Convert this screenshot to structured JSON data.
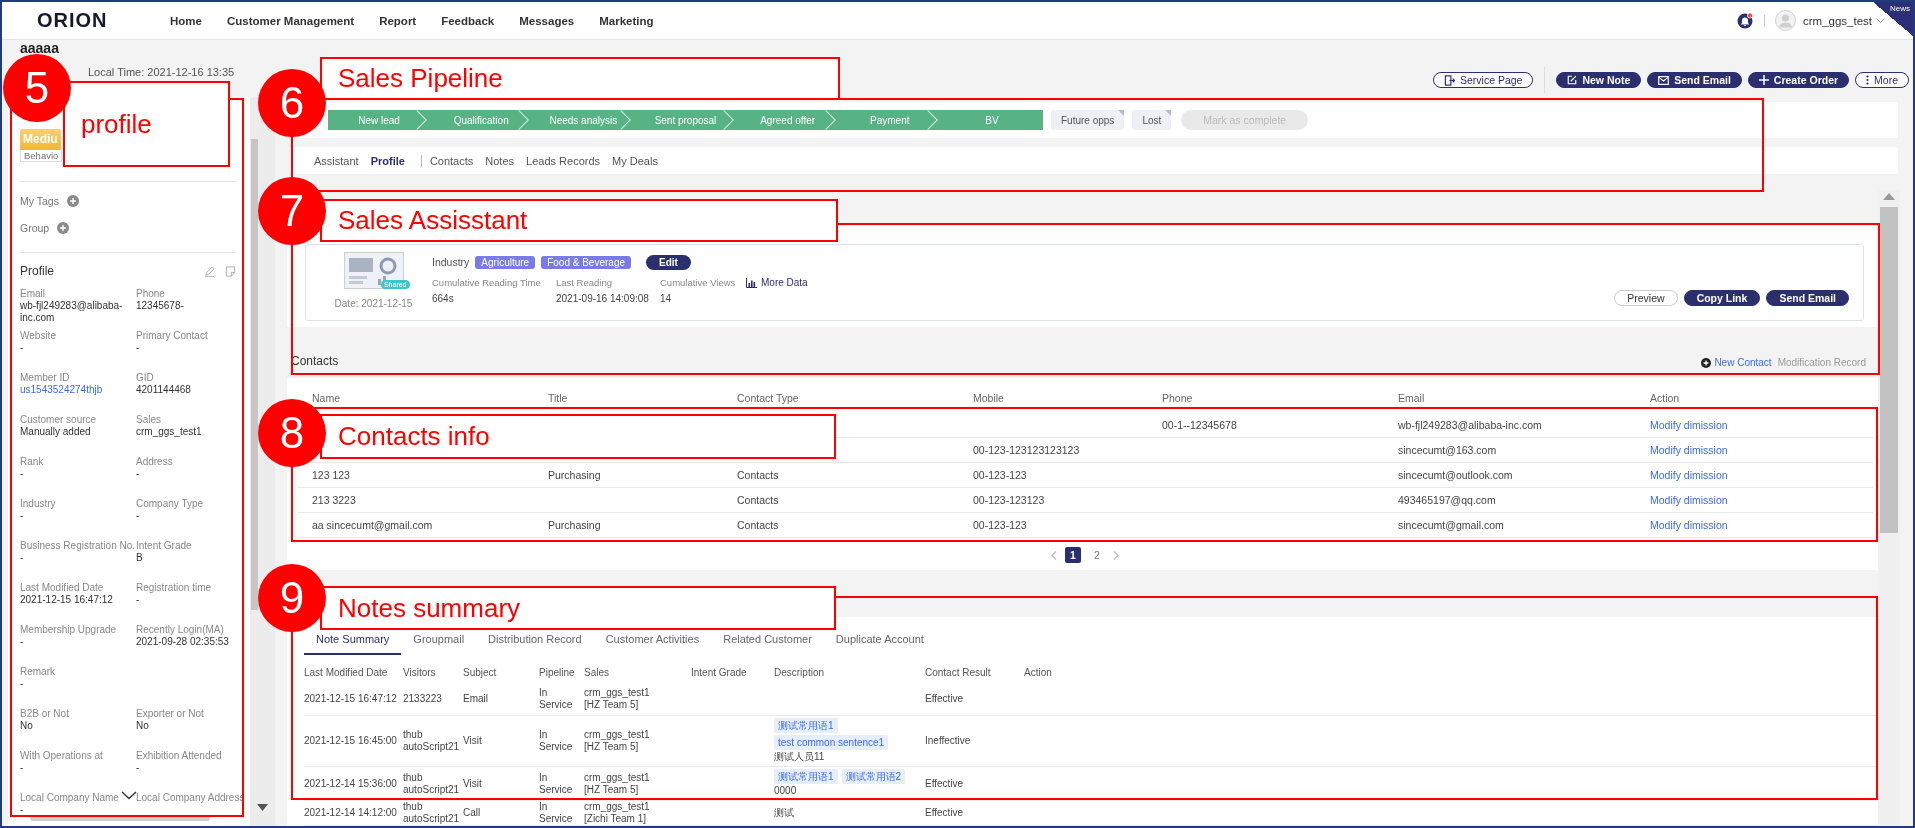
{
  "top_bar": {
    "logo": "ORION",
    "nav": [
      {
        "label": "Home"
      },
      {
        "label": "Customer Management"
      },
      {
        "label": "Report"
      },
      {
        "label": "Feedback"
      },
      {
        "label": "Messages"
      },
      {
        "label": "Marketing"
      }
    ],
    "notifications_unread": true,
    "user": "crm_ggs_test",
    "news": "News"
  },
  "header": {
    "title": "aaaaa",
    "local_time": "Local Time: 2021-12-16 13:35",
    "actions": [
      {
        "label": "Service Page",
        "kind": "service"
      },
      {
        "label": "New Note",
        "kind": "note"
      },
      {
        "label": "Send Email",
        "kind": "email"
      },
      {
        "label": "Create Order",
        "kind": "create"
      },
      {
        "label": "More",
        "kind": "more"
      }
    ]
  },
  "profile_panel": {
    "level_badge": "Mediu",
    "behavior_tag": "Behavio",
    "my_tags": "My Tags",
    "group": "Group",
    "heading": "Profile",
    "fields": [
      {
        "label": "Email",
        "value": "wb-fjl249283@alibaba-inc.com",
        "kind": "text"
      },
      {
        "label": "Phone",
        "value": "12345678-",
        "kind": "text"
      },
      {
        "label": "Website",
        "value": "-",
        "kind": "text"
      },
      {
        "label": "Primary Contact",
        "value": "-",
        "kind": "text"
      },
      {
        "label": "Member ID",
        "value": "us1543524274thjb",
        "kind": "link"
      },
      {
        "label": "GID",
        "value": "4201144468",
        "kind": "text"
      },
      {
        "label": "Customer source",
        "value": "Manually added",
        "kind": "text"
      },
      {
        "label": "Sales",
        "value": "crm_ggs_test1",
        "kind": "text"
      },
      {
        "label": "Rank",
        "value": "-",
        "kind": "text"
      },
      {
        "label": "Address",
        "value": "-",
        "kind": "text"
      },
      {
        "label": "Industry",
        "value": "-",
        "kind": "text"
      },
      {
        "label": "Company Type",
        "value": "-",
        "kind": "text"
      },
      {
        "label": "Business Registration No.",
        "value": "-",
        "kind": "text"
      },
      {
        "label": "Intent Grade",
        "value": "B",
        "kind": "text"
      },
      {
        "label": "Last Modified Date",
        "value": "2021-12-15 16:47:12",
        "kind": "text"
      },
      {
        "label": "Registration time",
        "value": "-",
        "kind": "text"
      },
      {
        "label": "Membership Upgrade",
        "value": "-",
        "kind": "text"
      },
      {
        "label": "Recently Login(MA)",
        "value": "2021-09-28 02:35:53",
        "kind": "text"
      },
      {
        "label": "Remark",
        "value": "-",
        "kind": "wide"
      },
      {
        "label": "B2B or Not",
        "value": "No",
        "kind": "text"
      },
      {
        "label": "Exporter or Not",
        "value": "No",
        "kind": "text"
      },
      {
        "label": "With Operations at",
        "value": "-",
        "kind": "text"
      },
      {
        "label": "Exhibition Attended",
        "value": "-",
        "kind": "text"
      },
      {
        "label": "Local Company Name",
        "value": "-",
        "kind": "text"
      },
      {
        "label": "Local Company Address",
        "kind": "text"
      }
    ]
  },
  "pipeline": {
    "stages": [
      {
        "label": "New lead",
        "done": true
      },
      {
        "label": "Qualification",
        "done": true
      },
      {
        "label": "Needs analysis",
        "done": true
      },
      {
        "label": "Sent proposal",
        "done": true
      },
      {
        "label": "Agreed offer",
        "done": true
      },
      {
        "label": "Payment",
        "done": true
      },
      {
        "label": "BV",
        "done": true
      }
    ],
    "outcomes": [
      {
        "label": "Future opps"
      },
      {
        "label": "Lost"
      }
    ],
    "complete": {
      "label": "Mark as complete",
      "disabled": true
    }
  },
  "tabs": [
    {
      "label": "Assistant",
      "selected": false
    },
    {
      "label": "Profile",
      "selected": true
    },
    {
      "label": "Contacts",
      "selected": false
    },
    {
      "label": "Notes",
      "selected": false
    },
    {
      "label": "Leads Records",
      "selected": false
    },
    {
      "label": "My Deals",
      "selected": false
    }
  ],
  "assistant": {
    "badge": "Shared",
    "date": "Date: 2021-12-15",
    "industry_label": "Industry",
    "tags": [
      {
        "label": "Agriculture"
      },
      {
        "label": "Food & Beverage"
      }
    ],
    "edit": "Edit",
    "stats": [
      {
        "label": "Cumulative Reading Time",
        "value": "664s"
      },
      {
        "label": "Last Reading",
        "value": "2021-09-16 14:09:08"
      },
      {
        "label": "Cumulative Views",
        "value": "14"
      }
    ],
    "more_data": "More Data",
    "buttons": [
      {
        "label": "Preview",
        "kind": "outline"
      },
      {
        "label": "Copy Link",
        "kind": "primary"
      },
      {
        "label": "Send Email",
        "kind": "primary"
      }
    ]
  },
  "contacts": {
    "title": "Contacts",
    "new_contact": "New Contact",
    "modification_record": "Modification Record",
    "columns": [
      "Name",
      "Title",
      "Contact Type",
      "Mobile",
      "Phone",
      "Email",
      "Action"
    ],
    "rows": [
      {
        "phone": "00-1--12345678",
        "email": "wb-fjl249283@alibaba-inc.com",
        "action": "Modify dimission"
      },
      {
        "mobile": "00-123-123123123123",
        "email": "sincecumt@163.com",
        "action": "Modify dimission"
      },
      {
        "name": "123 123",
        "title": "Purchasing",
        "contact_type": "Contacts",
        "mobile": "00-123-123",
        "email": "sincecumt@outlook.com",
        "action": "Modify dimission"
      },
      {
        "name": "213 3223",
        "contact_type": "Contacts",
        "mobile": "00-123-123123",
        "email": "493465197@qq.com",
        "action": "Modify dimission"
      },
      {
        "name": "aa sincecumt@gmail.com",
        "title": "Purchasing",
        "contact_type": "Contacts",
        "mobile": "00-123-123",
        "email": "sincecumt@gmail.com",
        "action": "Modify dimission"
      }
    ],
    "pages": [
      {
        "label": "1",
        "selected": true
      },
      {
        "label": "2",
        "selected": false
      }
    ]
  },
  "notes": {
    "tabs": [
      {
        "label": "Note Summary",
        "selected": true
      },
      {
        "label": "Groupmail",
        "selected": false
      },
      {
        "label": "Distribution Record",
        "selected": false
      },
      {
        "label": "Customer Activities",
        "selected": false
      },
      {
        "label": "Related Customer",
        "selected": false
      },
      {
        "label": "Duplicate Account",
        "selected": false
      }
    ],
    "columns": [
      "Last Modified Date",
      "Visitors",
      "Subject",
      "Pipeline",
      "Sales",
      "Intent Grade",
      "Description",
      "Contact Result",
      "Action"
    ],
    "rows": [
      {
        "date": "2021-12-15 16:47:12",
        "visitor": "2133223",
        "subject": "Email",
        "pipeline": "In Service",
        "sales": "crm_ggs_test1 [HZ Team 5]",
        "result": "Effective"
      },
      {
        "date": "2021-12-15 16:45:00",
        "visitor": "thub autoScript21",
        "subject": "Visit",
        "pipeline": "In Service",
        "sales": "crm_ggs_test1 [HZ Team 5]",
        "description_tags": [
          "测试常用语1",
          "test common sentence1"
        ],
        "description": "测试人员11",
        "result": "Ineffective"
      },
      {
        "date": "2021-12-14 15:36:00",
        "visitor": "thub autoScript21",
        "subject": "Visit",
        "pipeline": "In Service",
        "sales": "crm_ggs_test1 [HZ Team 5]",
        "description_tags": [
          "测试常用语1",
          "测试常用语2"
        ],
        "description": "0000",
        "result": "Effective"
      },
      {
        "date": "2021-12-14 14:12:00",
        "visitor": "thub autoScript21",
        "subject": "Call",
        "pipeline": "In Service",
        "sales": "crm_ggs_test1 [Zichi Team 1]",
        "description": "测试",
        "result": "Effective"
      }
    ]
  },
  "annotations": [
    {
      "number": "5",
      "label": "profile"
    },
    {
      "number": "6",
      "label": "Sales Pipeline"
    },
    {
      "number": "7",
      "label": "Sales Assisstant"
    },
    {
      "number": "8",
      "label": "Contacts info"
    },
    {
      "number": "9",
      "label": "Notes summary"
    }
  ]
}
